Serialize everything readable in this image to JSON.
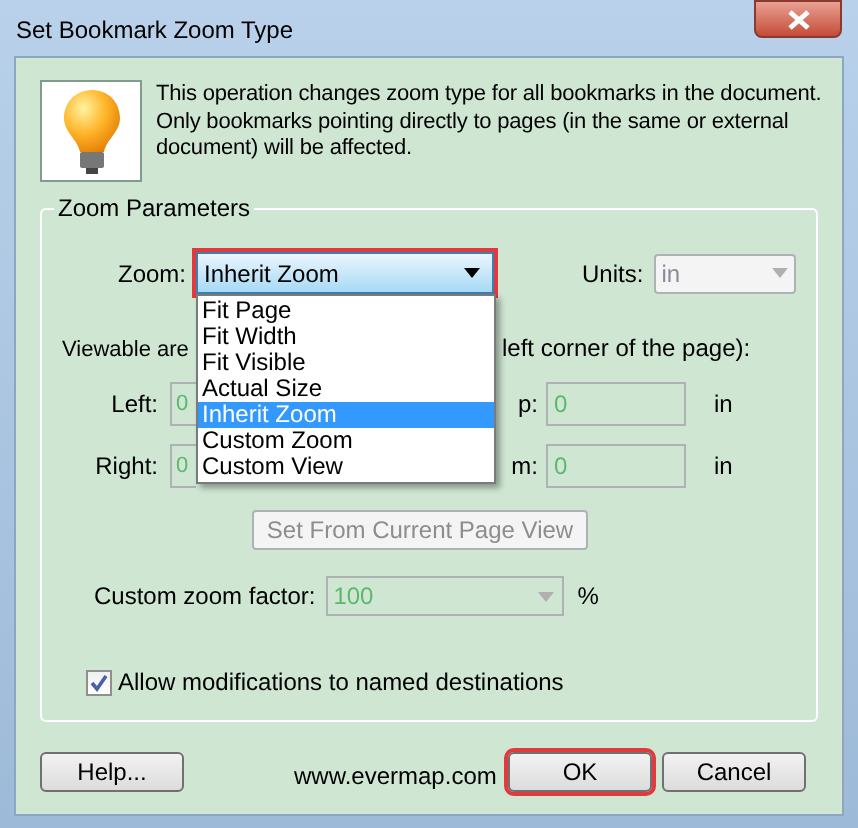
{
  "window": {
    "title": "Set Bookmark Zoom Type"
  },
  "message": "This operation changes zoom type for all bookmarks in the document. Only bookmarks pointing directly to pages (in the same or external document) will be affected.",
  "group": {
    "title": "Zoom Parameters"
  },
  "zoom": {
    "label": "Zoom:",
    "value": "Inherit Zoom",
    "highlighted": true
  },
  "zoom_options": [
    {
      "label": "Fit Page",
      "selected": false
    },
    {
      "label": "Fit Width",
      "selected": false
    },
    {
      "label": "Fit Visible",
      "selected": false
    },
    {
      "label": "Actual Size",
      "selected": false
    },
    {
      "label": "Inherit Zoom",
      "selected": true
    },
    {
      "label": "Custom Zoom",
      "selected": false
    },
    {
      "label": "Custom View",
      "selected": false
    }
  ],
  "units": {
    "label": "Units:",
    "value": "in",
    "disabled": true
  },
  "viewable": {
    "left_part": "Viewable are",
    "right_part": "left corner of the page):"
  },
  "coords": [
    {
      "label": "Left:",
      "value": "0",
      "other_label": "p:",
      "other_value": "0",
      "unit": "in"
    },
    {
      "label": "Right:",
      "value": "0",
      "other_label": "m:",
      "other_value": "0",
      "unit": "in"
    }
  ],
  "set_button": {
    "label": "Set From Current Page View",
    "disabled": true
  },
  "custom_zoom": {
    "label": "Custom zoom factor:",
    "value": "100",
    "unit": "%",
    "disabled": true
  },
  "allow_checkbox": {
    "label": "Allow modifications to named destinations",
    "checked": true
  },
  "help_button": {
    "label": "Help...",
    "highlighted": false
  },
  "website": "www.evermap.com",
  "buttons": [
    {
      "label": "OK",
      "highlighted": true
    },
    {
      "label": "Cancel",
      "highlighted": false
    }
  ]
}
